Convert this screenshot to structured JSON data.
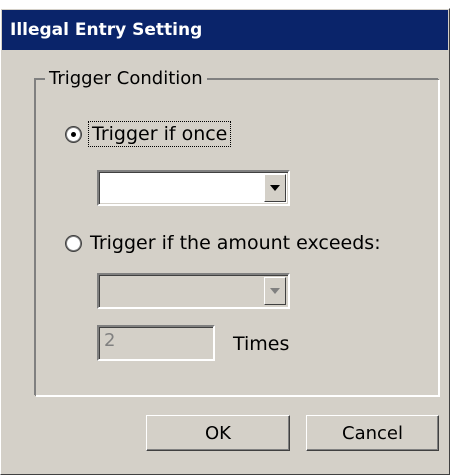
{
  "window": {
    "title": "Illegal Entry Setting"
  },
  "group": {
    "legend": "Trigger Condition"
  },
  "options": {
    "once": {
      "label": "Trigger if once",
      "checked": true
    },
    "exceeds": {
      "label": "Trigger if the amount exceeds:",
      "checked": false
    }
  },
  "once_combo": {
    "value": ""
  },
  "exceeds_combo": {
    "value": ""
  },
  "times": {
    "value": "2",
    "label": "Times"
  },
  "buttons": {
    "ok": "OK",
    "cancel": "Cancel"
  }
}
